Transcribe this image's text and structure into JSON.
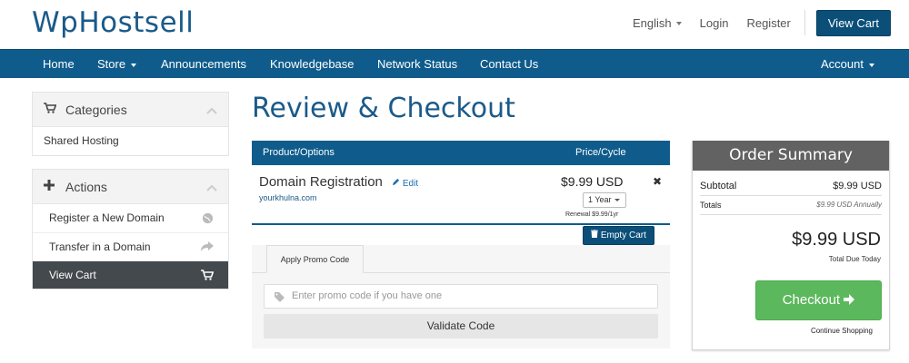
{
  "brand": {
    "logo": "WpHostsell",
    "accent": "#0f5c8c",
    "success": "#5cb85c"
  },
  "topbar": {
    "language": "English",
    "login": "Login",
    "register": "Register",
    "view_cart": "View Cart"
  },
  "nav": {
    "items": [
      {
        "label": "Home"
      },
      {
        "label": "Store",
        "dropdown": true
      },
      {
        "label": "Announcements"
      },
      {
        "label": "Knowledgebase"
      },
      {
        "label": "Network Status"
      },
      {
        "label": "Contact Us"
      }
    ],
    "account": "Account"
  },
  "sidebar": {
    "categories": {
      "title": "Categories",
      "icon": "cart-icon",
      "items": [
        {
          "label": "Shared Hosting"
        }
      ]
    },
    "actions": {
      "title": "Actions",
      "icon": "plus-icon",
      "items": [
        {
          "label": "Register a New Domain",
          "icon": "globe-icon"
        },
        {
          "label": "Transfer in a Domain",
          "icon": "share-icon"
        },
        {
          "label": "View Cart",
          "icon": "cart-icon",
          "active": true
        }
      ]
    }
  },
  "page": {
    "title": "Review & Checkout"
  },
  "cart": {
    "headers": {
      "product": "Product/Options",
      "price": "Price/Cycle"
    },
    "items": [
      {
        "name": "Domain Registration",
        "edit": "Edit",
        "domain": "yourkhulna.com",
        "price": "$9.99 USD",
        "cycle": "1 Year",
        "renewal": "Renewal $9.99/1yr"
      }
    ],
    "empty_cart": "Empty Cart"
  },
  "promo": {
    "tab": "Apply Promo Code",
    "placeholder": "Enter promo code if you have one",
    "validate": "Validate Code"
  },
  "summary": {
    "title": "Order Summary",
    "subtotal_label": "Subtotal",
    "subtotal_value": "$9.99 USD",
    "totals_label": "Totals",
    "totals_value": "$9.99 USD Annually",
    "total_due": "$9.99 USD",
    "total_due_label": "Total Due Today",
    "checkout": "Checkout",
    "continue": "Continue Shopping"
  }
}
